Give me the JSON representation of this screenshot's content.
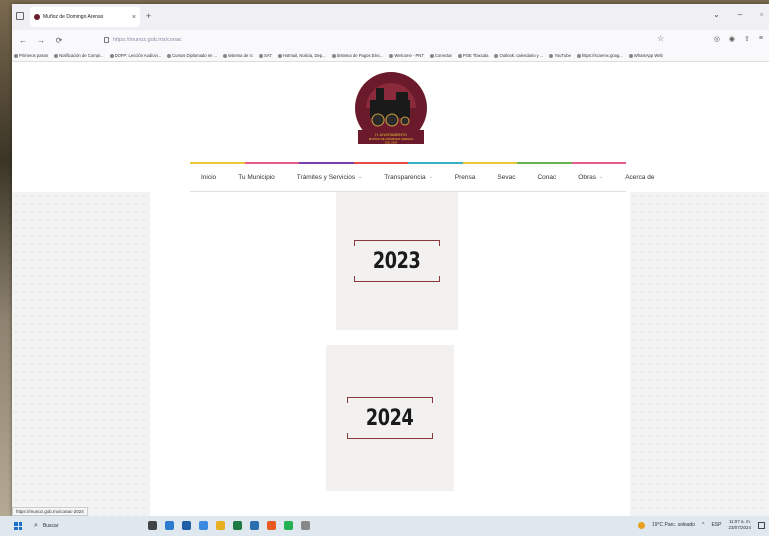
{
  "browser": {
    "tab_title": "Muñoz de Domingo Arenas",
    "url": "https://munoz.gob.mx/conac",
    "status_url": "https://munoz.gob.mx/conac-2024"
  },
  "bookmarks": [
    "Primeros pasos",
    "Notificación de Compr...",
    "DOFP: Lección Audiovi...",
    "Cursos Diplomado en ...",
    "sistema de rc",
    "SAT",
    "Hotmail, Noticia, Dep...",
    "Sistema de Pagos Elec...",
    "Welcome - PNT",
    "Conectar",
    "POE Tlaxcala",
    "Outlook: calendario y ...",
    "YouTube",
    "https://scoemx.goog...",
    "WhatsApp Web"
  ],
  "site": {
    "logo_alt": "H. AYUNTAMIENTO MUÑOZ DE DOMINGO ARENAS 2021-2024",
    "menu": [
      {
        "label": "Inicio",
        "dropdown": false
      },
      {
        "label": "Tu Municipio",
        "dropdown": false
      },
      {
        "label": "Trámites y Servicios",
        "dropdown": true
      },
      {
        "label": "Transparencia",
        "dropdown": true
      },
      {
        "label": "Prensa",
        "dropdown": false
      },
      {
        "label": "Sevac",
        "dropdown": false
      },
      {
        "label": "Conac",
        "dropdown": false
      },
      {
        "label": "Obras",
        "dropdown": true
      },
      {
        "label": "Acerca de",
        "dropdown": false
      }
    ],
    "stripe_colors": [
      "#e8c83a",
      "#e85a8c",
      "#7a3fa8",
      "#e84a4a",
      "#3ab0c8",
      "#e8c83a",
      "#6ab04c",
      "#e85a8c"
    ],
    "years": [
      "2023",
      "2024"
    ],
    "accent_color": "#8a3a3a"
  },
  "taskbar": {
    "search_placeholder": "Buscar",
    "weather": "19°C Parc. soleado",
    "lang": "ESP",
    "time": "11:07 a. m.",
    "date": "23/07/2024"
  }
}
